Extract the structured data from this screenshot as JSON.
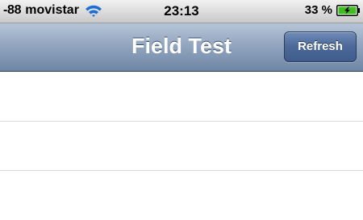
{
  "status_bar": {
    "signal_strength": "-88",
    "carrier": "movistar",
    "time": "23:13",
    "battery": "33 %",
    "icons": [
      "wifi-icon",
      "battery-charging-icon"
    ]
  },
  "nav_bar": {
    "title": "Field Test",
    "refresh_label": "Refresh"
  },
  "table": {
    "rows": [
      "",
      "",
      ""
    ]
  },
  "colors": {
    "nav_bar": "#8fa3bd",
    "button": "#4c6898",
    "battery_fill": "#3fbf1f"
  }
}
